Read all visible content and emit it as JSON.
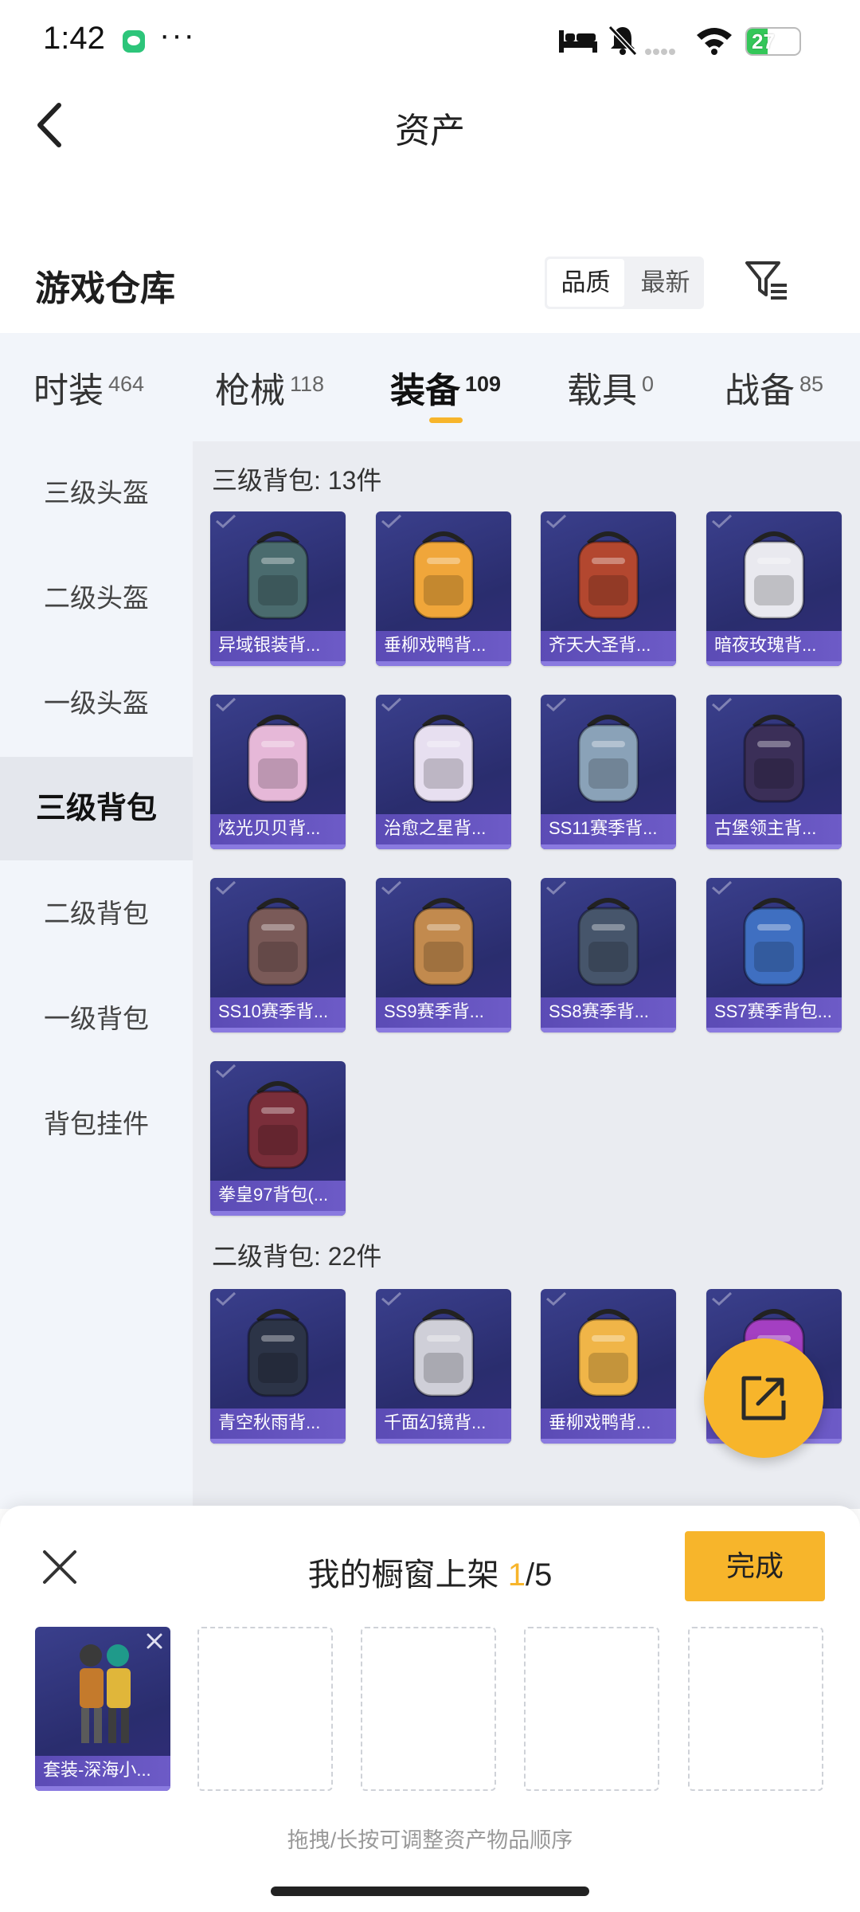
{
  "status_bar": {
    "time": "1:42",
    "dots": "···",
    "battery": "27"
  },
  "nav": {
    "title": "资产"
  },
  "warehouse": {
    "title": "游戏仓库",
    "sort": [
      {
        "label": "品质"
      },
      {
        "label": "最新"
      }
    ]
  },
  "tabs": [
    {
      "label": "时装",
      "count": "464"
    },
    {
      "label": "枪械",
      "count": "118"
    },
    {
      "label": "装备",
      "count": "109"
    },
    {
      "label": "载具",
      "count": "0"
    },
    {
      "label": "战备",
      "count": "85"
    }
  ],
  "sidebar": [
    {
      "label": "三级头盔"
    },
    {
      "label": "二级头盔"
    },
    {
      "label": "一级头盔"
    },
    {
      "label": "三级背包"
    },
    {
      "label": "二级背包"
    },
    {
      "label": "一级背包"
    },
    {
      "label": "背包挂件"
    }
  ],
  "sections": [
    {
      "title": "三级背包: 13件",
      "items": [
        {
          "name": "异域银装背...",
          "icon": "backpack-icon",
          "color": "#4a6b6e"
        },
        {
          "name": "垂柳戏鸭背...",
          "icon": "duck-backpack-icon",
          "color": "#f0a63a"
        },
        {
          "name": "齐天大圣背...",
          "icon": "monkey-king-backpack-icon",
          "color": "#b3472f"
        },
        {
          "name": "暗夜玫瑰背...",
          "icon": "bear-backpack-icon",
          "color": "#e9e9ef"
        },
        {
          "name": "炫光贝贝背...",
          "icon": "doll-backpack-icon",
          "color": "#e6b8d8"
        },
        {
          "name": "治愈之星背...",
          "icon": "robot-backpack-icon",
          "color": "#e7dff0"
        },
        {
          "name": "SS11赛季背...",
          "icon": "backpack-icon",
          "color": "#8aa2b8"
        },
        {
          "name": "古堡领主背...",
          "icon": "bat-backpack-icon",
          "color": "#3b2f58"
        },
        {
          "name": "SS10赛季背...",
          "icon": "backpack-icon",
          "color": "#7a5a58"
        },
        {
          "name": "SS9赛季背...",
          "icon": "backpack-icon",
          "color": "#c28a4e"
        },
        {
          "name": "SS8赛季背...",
          "icon": "backpack-icon",
          "color": "#46556b"
        },
        {
          "name": "SS7赛季背包...",
          "icon": "backpack-icon",
          "color": "#3f6fc1"
        },
        {
          "name": "拳皇97背包(...",
          "icon": "fighter-backpack-icon",
          "color": "#7a2e3a"
        }
      ]
    },
    {
      "title": "二级背包: 22件",
      "items": [
        {
          "name": "青空秋雨背...",
          "icon": "backpack-icon",
          "color": "#2c3447"
        },
        {
          "name": "千面幻镜背...",
          "icon": "crystal-backpack-icon",
          "color": "#cfcfd8"
        },
        {
          "name": "垂柳戏鸭背...",
          "icon": "duck-backpack-icon",
          "color": "#f0b548"
        },
        {
          "name": "",
          "icon": "backpack-icon",
          "color": "#a43fc2"
        }
      ]
    }
  ],
  "showcase": {
    "title_prefix": "我的橱窗上架 ",
    "count": "1",
    "total": "/5",
    "done_label": "完成",
    "hint": "拖拽/长按可调整资产物品顺序",
    "filled_item": "套装-深海小..."
  },
  "colors": {
    "accent": "#f7b52b",
    "card_bg": "#2f3275",
    "card_caption": "#6252bd"
  }
}
